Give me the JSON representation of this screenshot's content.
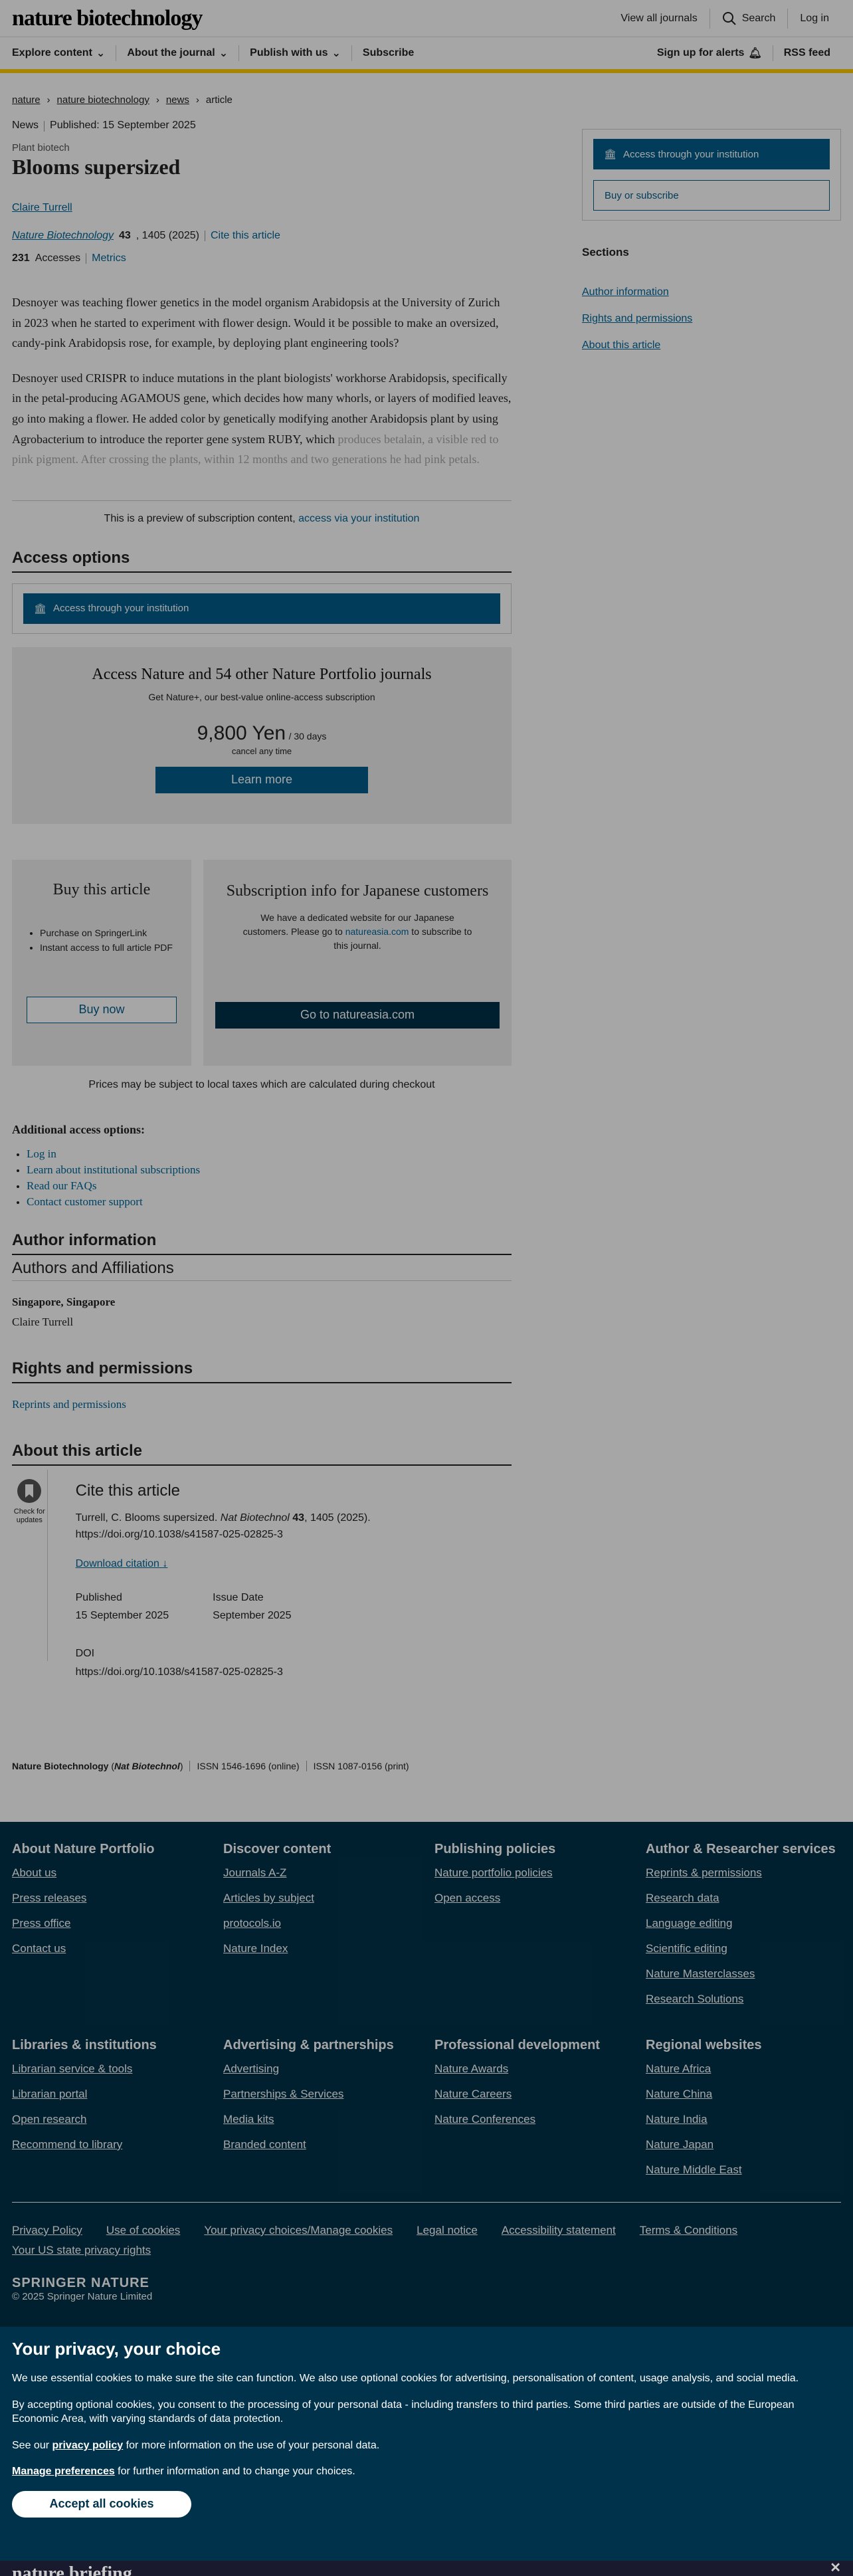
{
  "header": {
    "logo": "nature biotechnology",
    "view_all": "View all journals",
    "search": "Search",
    "login": "Log in"
  },
  "nav": {
    "explore": "Explore content",
    "about": "About the journal",
    "publish": "Publish with us",
    "subscribe": "Subscribe",
    "alerts": "Sign up for alerts",
    "rss": "RSS feed"
  },
  "breadcrumb": [
    "nature",
    "nature biotechnology",
    "news",
    "article"
  ],
  "article": {
    "type": "News",
    "published": "Published: 15 September 2025",
    "subject": "Plant biotech",
    "title": "Blooms supersized",
    "author": "Claire Turrell",
    "journal": "Nature Biotechnology",
    "volume": "43",
    "pages": ", 1405 (2025)",
    "cite_label": "Cite this article",
    "accesses": "231",
    "accesses_label": "Accesses",
    "metrics": "Metrics",
    "p1": "Desnoyer was teaching flower genetics in the model organism Arabidopsis at the University of Zurich in 2023 when he started to experiment with flower design. Would it be possible to make an oversized, candy-pink Arabidopsis rose, for example, by deploying plant engineering tools?",
    "p2": "Desnoyer used CRISPR to induce mutations in the plant biologists' workhorse Arabidopsis, specifically in the petal-producing AGAMOUS gene, which decides how many whorls, or layers of modified leaves, go into making a flower. He added color by genetically modifying another Arabidopsis plant by using Agrobacterium to introduce the reporter gene system RUBY, which",
    "p2_fade": "produces betalain, a visible red to pink pigment. After crossing the plants, within 12 months and two generations he had pink petals."
  },
  "preview": {
    "text": "This is a preview of subscription content,",
    "link": "access via your institution"
  },
  "access": {
    "heading": "Access options",
    "institution_btn": "Access through your institution",
    "natureplus_title": "Access Nature and 54 other Nature Portfolio journals",
    "natureplus_sub": "Get Nature+, our best-value online-access subscription",
    "price": "9,800 Yen",
    "per": "/ 30 days",
    "cancel": "cancel any time",
    "learn": "Learn more",
    "buy_title": "Buy this article",
    "buy_items": [
      "Purchase on SpringerLink",
      "Instant access to full article PDF"
    ],
    "buy_btn": "Buy now",
    "jp_title": "Subscription info for Japanese customers",
    "jp_text1": "We have a dedicated website for our Japanese customers. Please go to ",
    "jp_link": "natureasia.com",
    "jp_text2": " to subscribe to this journal.",
    "jp_btn": "Go to natureasia.com",
    "taxes": "Prices may be subject to local taxes which are calculated during checkout"
  },
  "additional": {
    "heading": "Additional access options:",
    "links": [
      "Log in",
      "Learn about institutional subscriptions",
      "Read our FAQs",
      "Contact customer support"
    ]
  },
  "author_info": {
    "heading": "Author information",
    "sub": "Authors and Affiliations",
    "location": "Singapore, Singapore",
    "name": "Claire Turrell"
  },
  "rights": {
    "heading": "Rights and permissions",
    "link": "Reprints and permissions"
  },
  "about": {
    "heading": "About this article",
    "check": "Check for updates",
    "cite_heading": "Cite this article",
    "citation_pre": "Turrell, C. Blooms supersized. ",
    "citation_journal": "Nat Biotechnol",
    "citation_vol": "43",
    "citation_post": ", 1405 (2025). https://doi.org/10.1038/s41587-025-02825-3",
    "download": "Download citation",
    "published_label": "Published",
    "published": "15 September 2025",
    "issue_label": "Issue Date",
    "issue": "September 2025",
    "doi_label": "DOI",
    "doi": "https://doi.org/10.1038/s41587-025-02825-3"
  },
  "issn": {
    "name": "Nature Biotechnology",
    "abbr": "Nat Biotechnol",
    "online": "ISSN 1546-1696 (online)",
    "print": "ISSN 1087-0156 (print)"
  },
  "sidebar": {
    "access_btn": "Access through your institution",
    "buy": "Buy or subscribe",
    "sections_title": "Sections",
    "sections": [
      "Author information",
      "Rights and permissions",
      "About this article"
    ]
  },
  "footer": {
    "cols": [
      {
        "title": "About Nature Portfolio",
        "links": [
          "About us",
          "Press releases",
          "Press office",
          "Contact us"
        ]
      },
      {
        "title": "Discover content",
        "links": [
          "Journals A-Z",
          "Articles by subject",
          "protocols.io",
          "Nature Index"
        ]
      },
      {
        "title": "Publishing policies",
        "links": [
          "Nature portfolio policies",
          "Open access"
        ]
      },
      {
        "title": "Author & Researcher services",
        "links": [
          "Reprints & permissions",
          "Research data",
          "Language editing",
          "Scientific editing",
          "Nature Masterclasses",
          "Research Solutions"
        ]
      },
      {
        "title": "Libraries & institutions",
        "links": [
          "Librarian service & tools",
          "Librarian portal",
          "Open research",
          "Recommend to library"
        ]
      },
      {
        "title": "Advertising & partnerships",
        "links": [
          "Advertising",
          "Partnerships & Services",
          "Media kits",
          "Branded content"
        ]
      },
      {
        "title": "Professional development",
        "links": [
          "Nature Awards",
          "Nature Careers",
          "Nature Conferences"
        ]
      },
      {
        "title": "Regional websites",
        "links": [
          "Nature Africa",
          "Nature China",
          "Nature India",
          "Nature Japan",
          "Nature Middle East"
        ]
      }
    ],
    "bottom_links": [
      "Privacy Policy",
      "Use of cookies",
      "Your privacy choices/Manage cookies",
      "Legal notice",
      "Accessibility statement",
      "Terms & Conditions",
      "Your US state privacy rights"
    ],
    "brand": "SPRINGER NATURE",
    "copyright": "© 2025 Springer Nature Limited"
  },
  "cookie": {
    "title": "Your privacy, your choice",
    "p1": "We use essential cookies to make sure the site can function. We also use optional cookies for advertising, personalisation of content, usage analysis, and social media.",
    "p2": "By accepting optional cookies, you consent to the processing of your personal data - including transfers to third parties. Some third parties are outside of the European Economic Area, with varying standards of data protection.",
    "p3a": "See our ",
    "p3link": "privacy policy",
    "p3b": " for more information on the use of your personal data.",
    "p4link": "Manage preferences",
    "p4b": " for further information and to change your choices.",
    "accept": "Accept all cookies"
  },
  "bottom_strip": {
    "logo": "nature briefing"
  }
}
